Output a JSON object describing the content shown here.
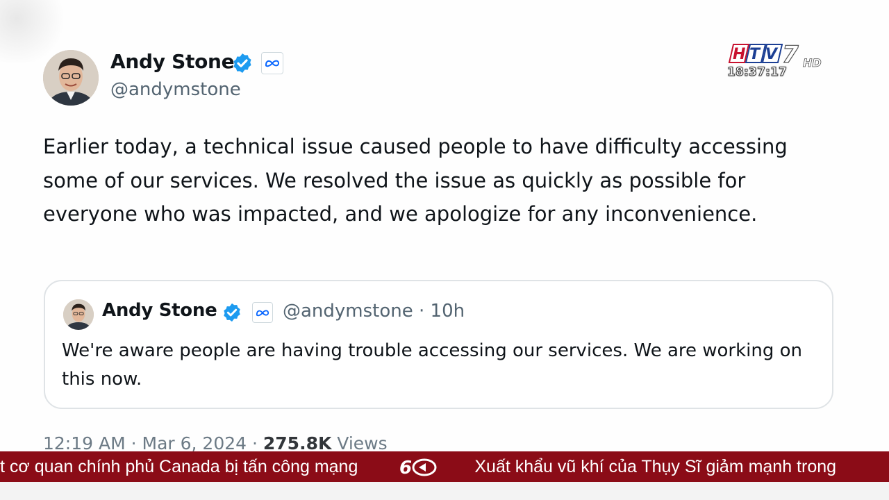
{
  "tweet": {
    "author_name": "Andy Stone",
    "author_handle": "@andymstone",
    "text": "Earlier today, a technical issue caused people to have difficulty accessing some of our services. We resolved the issue as quickly as possible for everyone who was impacted, and we apologize for any inconvenience.",
    "timestamp": "12:19 AM · Mar 6, 2024 ·",
    "views_count": "275.8K",
    "views_label": "Views"
  },
  "quoted_tweet": {
    "author_name": "Andy Stone",
    "handle_and_time": "@andymstone · 10h",
    "text": "We're aware people are having trouble accessing our services. We are working on this now."
  },
  "broadcast": {
    "channel_logo": "HTV7 HD",
    "clock": "18:37:17"
  },
  "ticker": {
    "items": [
      "t cơ quan chính phủ Canada bị tấn công mạng",
      "Xuất khẩu vũ khí của Thụy Sĩ giảm mạnh trong"
    ],
    "separator_icon": "60-giay-logo-icon"
  },
  "colors": {
    "verified_blue": "#1d9bf0",
    "meta_blue": "#0866ff",
    "ticker_bg": "#8b0c17",
    "secondary_text": "#536471"
  }
}
